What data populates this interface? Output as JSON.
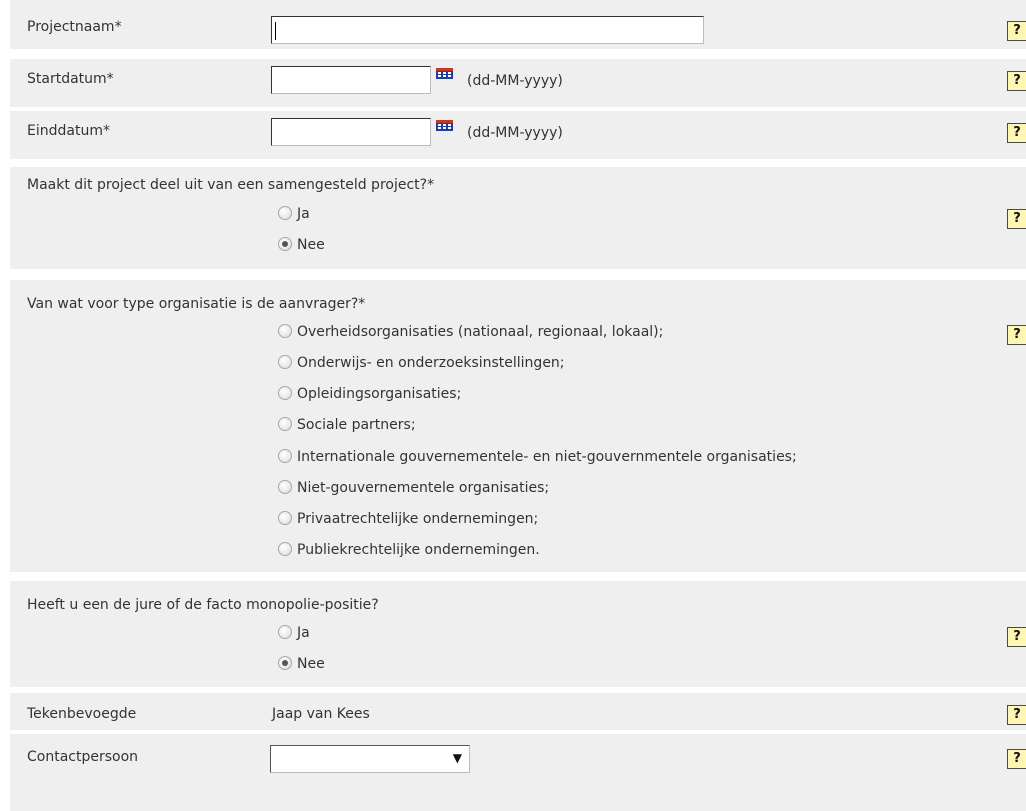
{
  "fields": {
    "projectnaam": {
      "label": "Projectnaam*",
      "value": ""
    },
    "startdatum": {
      "label": "Startdatum*",
      "value": "",
      "hint": "(dd-MM-yyyy)"
    },
    "einddatum": {
      "label": "Einddatum*",
      "value": "",
      "hint": "(dd-MM-yyyy)"
    },
    "samengesteld": {
      "question": "Maakt dit project deel uit van een samengesteld project?*",
      "options": [
        "Ja",
        "Nee"
      ],
      "selected": "Nee"
    },
    "organisatie": {
      "question": "Van wat voor type organisatie is de aanvrager?*",
      "options": [
        "Overheidsorganisaties (nationaal, regionaal, lokaal);",
        "Onderwijs- en onderzoeksinstellingen;",
        "Opleidingsorganisaties;",
        "Sociale partners;",
        "Internationale gouvernementele- en niet-gouvernmentele organisaties;",
        "Niet-gouvernementele organisaties;",
        "Privaatrechtelijke ondernemingen;",
        "Publiekrechtelijke ondernemingen."
      ],
      "selected": ""
    },
    "monopolie": {
      "question": "Heeft u een de jure of de facto monopolie-positie?",
      "options": [
        "Ja",
        "Nee"
      ],
      "selected": "Nee"
    },
    "tekenbevoegde": {
      "label": "Tekenbevoegde",
      "value": "Jaap van Kees"
    },
    "contactpersoon": {
      "label": "Contactpersoon",
      "selected": "",
      "arrow": "▼"
    }
  },
  "help_label": "?",
  "icons": {
    "help": "help-icon",
    "calendar": "calendar-icon"
  },
  "colors": {
    "row_bg": "#efefef",
    "help_bg": "#fef7b3"
  }
}
